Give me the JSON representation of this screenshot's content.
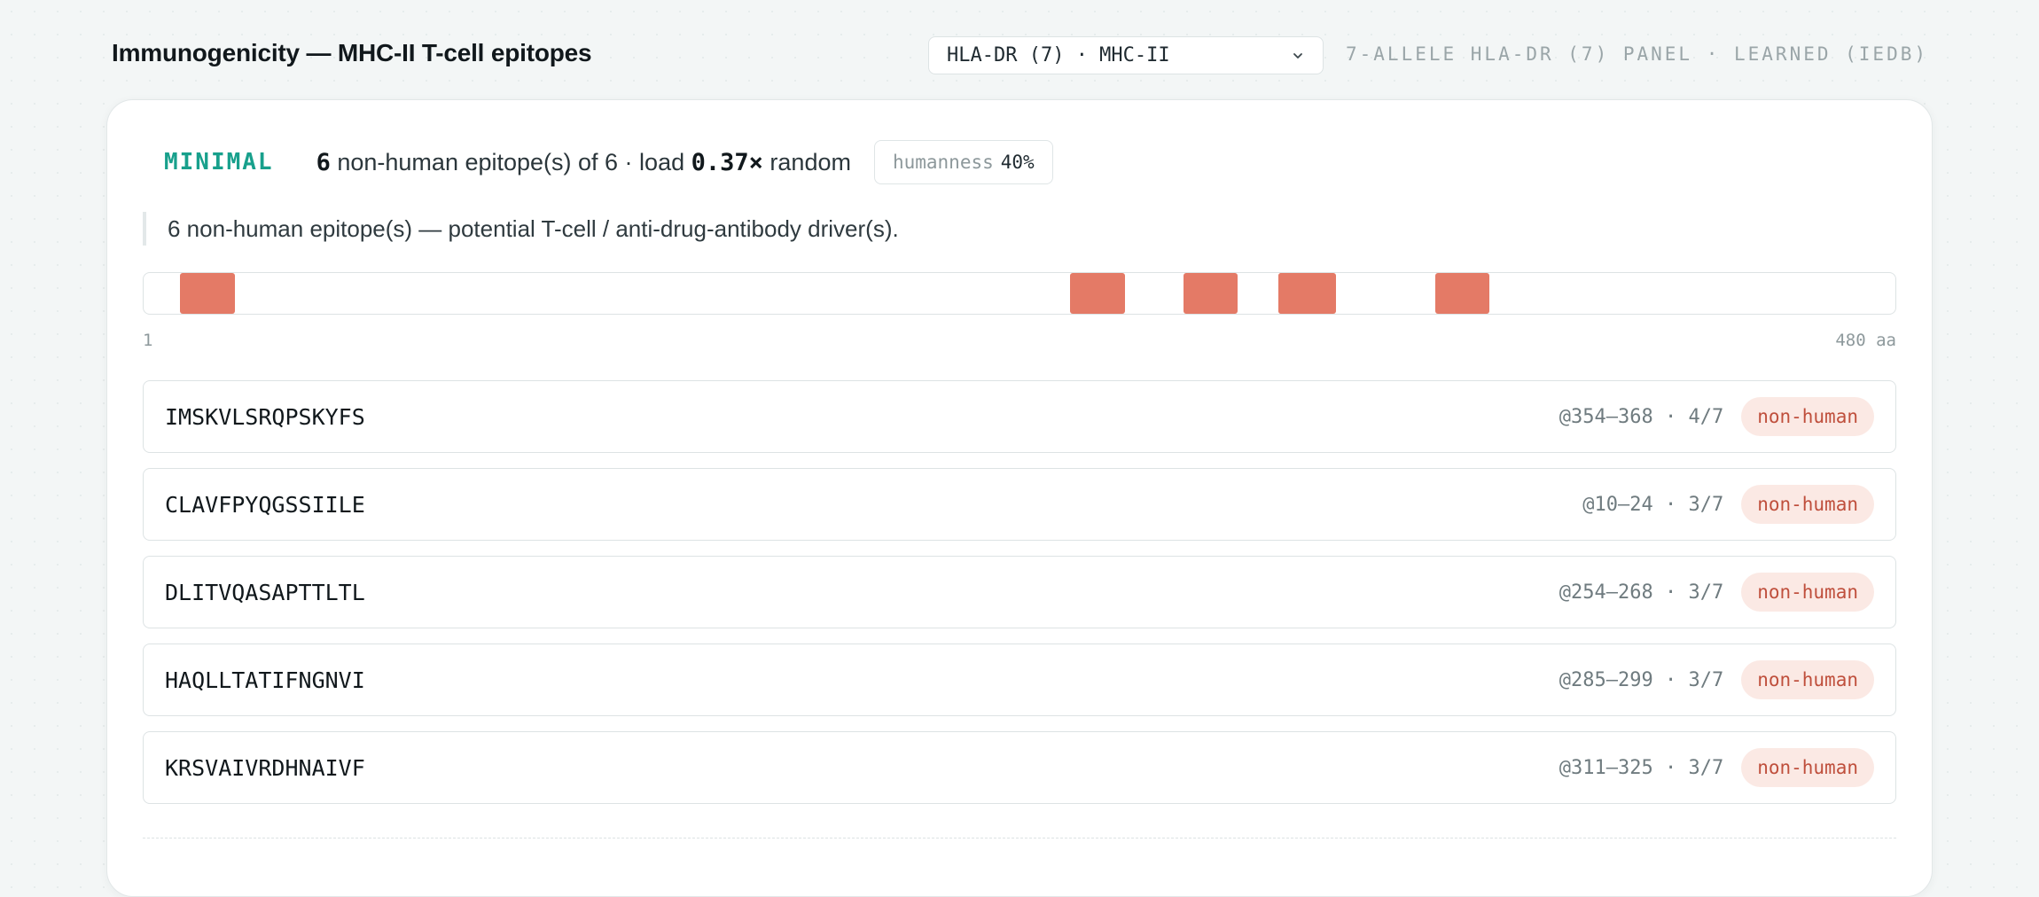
{
  "header": {
    "title": "Immunogenicity — MHC-II T-cell epitopes",
    "panel_select_value": "HLA-DR (7) · MHC-II",
    "panel_caption": "7-ALLELE HLA-DR (7) PANEL · LEARNED (IEDB)"
  },
  "summary": {
    "verdict": "MINIMAL",
    "epitope_count": "6",
    "text_a": "non-human epitope(s) of 6 · load",
    "load_value": "0.37×",
    "text_b": "random",
    "humanness_label": "humanness",
    "humanness_value": "40%"
  },
  "note": "6 non-human epitope(s) — potential T-cell / anti-drug-antibody driver(s).",
  "track": {
    "start_label": "1",
    "end_label": "480 aa",
    "length": 480,
    "epitopes": [
      {
        "start": 10,
        "end": 24
      },
      {
        "start": 254,
        "end": 268
      },
      {
        "start": 285,
        "end": 299
      },
      {
        "start": 311,
        "end": 325
      },
      {
        "start": 311,
        "end": 326
      },
      {
        "start": 354,
        "end": 368
      }
    ]
  },
  "epitope_rows": [
    {
      "sequence": "IMSKVLSRQPSKYFS",
      "meta": "@354–368 · 4/7",
      "badge": "non-human"
    },
    {
      "sequence": "CLAVFPYQGSSIILE",
      "meta": "@10–24 · 3/7",
      "badge": "non-human"
    },
    {
      "sequence": "DLITVQASAPTTLTL",
      "meta": "@254–268 · 3/7",
      "badge": "non-human"
    },
    {
      "sequence": "HAQLLTATIFNGNVI",
      "meta": "@285–299 · 3/7",
      "badge": "non-human"
    },
    {
      "sequence": "KRSVAIVRDHNAIVF",
      "meta": "@311–325 · 3/7",
      "badge": "non-human"
    }
  ],
  "colors": {
    "accent": "#18a08c",
    "epitope_block": "#e47a66",
    "badge_bg": "#fbe9e4",
    "badge_text": "#bf4f3c"
  }
}
